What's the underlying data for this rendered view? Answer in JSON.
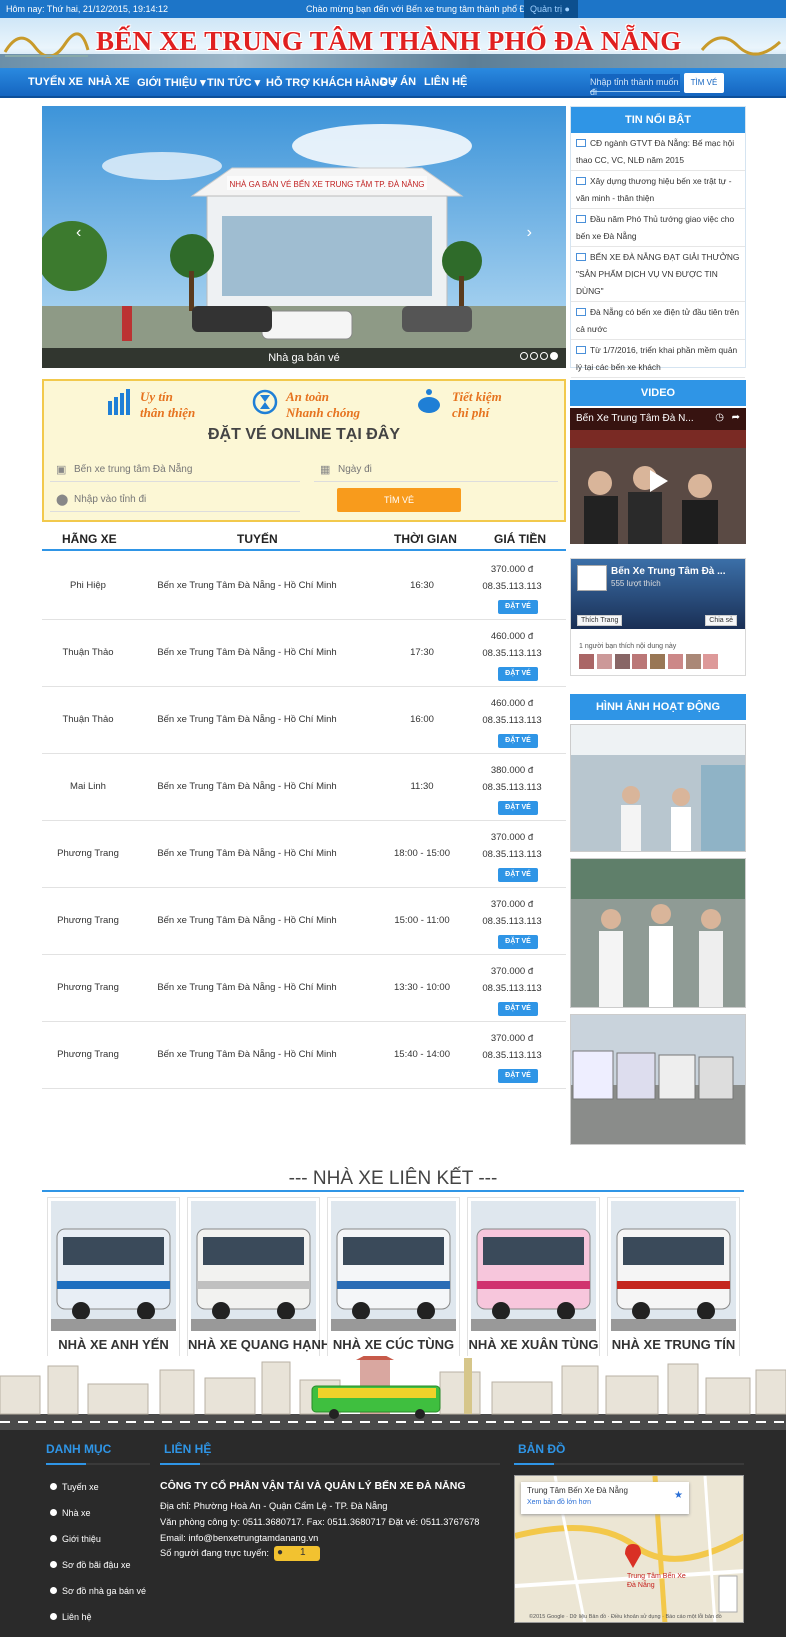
{
  "topbar": {
    "date": "Hôm nay: Thứ hai, 21/12/2015, 19:14:12",
    "welcome": "Chào mừng bạn đến với Bến xe trung tâm thành phố Đà Nẵng",
    "admin": "Quản trị"
  },
  "header": {
    "title": "BẾN XE TRUNG TÂM THÀNH PHỐ ĐÀ NẴNG"
  },
  "nav": {
    "items": [
      "TUYẾN XE",
      "NHÀ XE",
      "GIỚI THIỆU ▾",
      "TIN TỨC ▾",
      "HỖ TRỢ KHÁCH HÀNG ▾",
      "DỰ ÁN",
      "LIÊN HỆ"
    ],
    "search_placeholder": "Nhập tỉnh thành muốn đi",
    "search_button": "TÌM VÉ"
  },
  "slider": {
    "caption": "Nhà ga bán vé",
    "sign": "NHÀ GA BÁN VÉ BẾN XE TRUNG TÂM TP. ĐÀ NẴNG",
    "slide_count": 4,
    "active": 4
  },
  "news": {
    "title": "TIN NỔI BẬT",
    "items": [
      "CĐ ngành GTVT Đà Nẵng: Bế mạc hội thao CC, VC, NLĐ năm 2015",
      "Xây dựng thương hiệu bến xe trật tự - văn minh - thân thiện",
      "Đầu năm Phó Thủ tướng giao việc cho bến xe Đà Nẵng",
      "BẾN XE ĐÀ NẴNG ĐẠT GIẢI THƯỞNG \"SẢN PHẨM DỊCH VỤ VN ĐƯỢC TIN DÙNG\"",
      "Đà Nẵng có bến xe điện tử đầu tiên trên cả nước",
      "Từ 1/7/2016, triển khai phần mềm quản lý tại các bến xe khách"
    ]
  },
  "booking": {
    "features": [
      {
        "line1": "Uy tín",
        "line2": "thân thiện"
      },
      {
        "line1": "An toàn",
        "line2": "Nhanh chóng"
      },
      {
        "line1": "Tiết kiệm",
        "line2": "chi phí"
      }
    ],
    "title": "ĐẶT VÉ ONLINE TẠI ĐÂY",
    "from_value": "Bến xe trung tâm Đà Nẵng",
    "date_placeholder": "Ngày đi",
    "to_placeholder": "Nhập vào tỉnh đi",
    "button": "TÌM VÉ"
  },
  "table": {
    "headers": [
      "HÃNG XE",
      "TUYẾN",
      "THỜI GIAN",
      "GIÁ TIỀN"
    ],
    "book_label": "ĐẶT VÉ",
    "rows": [
      {
        "company": "Phi Hiệp",
        "route": "Bến xe Trung Tâm Đà Nẵng - Hồ Chí Minh",
        "time": "16:30",
        "price": "370.000 đ",
        "phone": "08.35.113.113"
      },
      {
        "company": "Thuận Thảo",
        "route": "Bến xe Trung Tâm Đà Nẵng - Hồ Chí Minh",
        "time": "17:30",
        "price": "460.000 đ",
        "phone": "08.35.113.113"
      },
      {
        "company": "Thuận Thảo",
        "route": "Bến xe Trung Tâm Đà Nẵng - Hồ Chí Minh",
        "time": "16:00",
        "price": "460.000 đ",
        "phone": "08.35.113.113"
      },
      {
        "company": "Mai Linh",
        "route": "Bến xe Trung Tâm Đà Nẵng - Hồ Chí Minh",
        "time": "11:30",
        "price": "380.000 đ",
        "phone": "08.35.113.113"
      },
      {
        "company": "Phương Trang",
        "route": "Bến xe Trung Tâm Đà Nẵng - Hồ Chí Minh",
        "time": "18:00 - 15:00",
        "price": "370.000 đ",
        "phone": "08.35.113.113"
      },
      {
        "company": "Phương Trang",
        "route": "Bến xe Trung Tâm Đà Nẵng - Hồ Chí Minh",
        "time": "15:00 - 11:00",
        "price": "370.000 đ",
        "phone": "08.35.113.113"
      },
      {
        "company": "Phương Trang",
        "route": "Bến xe Trung Tâm Đà Nẵng - Hồ Chí Minh",
        "time": "13:30 - 10:00",
        "price": "370.000 đ",
        "phone": "08.35.113.113"
      },
      {
        "company": "Phương Trang",
        "route": "Bến xe Trung Tâm Đà Nẵng - Hồ Chí Minh",
        "time": "15:40 - 14:00",
        "price": "370.000 đ",
        "phone": "08.35.113.113"
      }
    ]
  },
  "video": {
    "title": "VIDEO",
    "video_title": "Bến Xe Trung Tâm Đà N..."
  },
  "facebook": {
    "page_name": "Bến Xe Trung Tâm Đà ...",
    "likes": "555 lượt thích",
    "like_button": "Thích Trang",
    "share_button": "Chia sẻ",
    "friends_text": "1 người bạn thích nội dung này"
  },
  "photos": {
    "title": "HÌNH ẢNH HOẠT ĐỘNG"
  },
  "partners": {
    "title": "--- NHÀ XE LIÊN KẾT ---",
    "items": [
      {
        "name": "NHÀ XE ANH YẾN",
        "color": "#e8eef5",
        "stripe": "#1f6fbf"
      },
      {
        "name": "NHÀ XE QUANG HẠNH",
        "color": "#f2f2f0",
        "stripe": "#c0c0c0"
      },
      {
        "name": "NHÀ XE CÚC TÙNG",
        "color": "#f4f6f8",
        "stripe": "#2a6cb5"
      },
      {
        "name": "NHÀ XE XUÂN TÙNG",
        "color": "#f7c6dc",
        "stripe": "#d0336f"
      },
      {
        "name": "NHÀ XE TRUNG TÍN",
        "color": "#f5f5f5",
        "stripe": "#c4261d"
      }
    ]
  },
  "footer": {
    "menu_title": "DANH MỤC",
    "menu": [
      "Tuyến xe",
      "Nhà xe",
      "Giới thiệu",
      "Sơ đồ bãi đậu xe",
      "Sơ đồ nhà ga bán vé",
      "Liên hệ"
    ],
    "contact_title": "LIÊN HỆ",
    "company": "CÔNG TY CỔ PHẦN VẬN TẢI VÀ QUẢN LÝ BẾN XE ĐÀ NẴNG",
    "address": "Địa chỉ: Phường Hoà An - Quận Cẩm Lệ - TP. Đà Nẵng",
    "office": "Văn phòng công ty: 0511.3680717. Fax: 0511.3680717 Đặt vé: 0511.3767678",
    "email": "Email: info@benxetrungtamdanang.vn",
    "online_label": "Số người đang trực tuyến:",
    "online_count": "1",
    "map_title": "BẢN ĐỒ",
    "map_place": "Trung Tâm Bến Xe Đà Nẵng",
    "map_link": "Xem bản đồ lớn hơn",
    "map_pin_label": "Trung Tâm Bến Xe Đà Nẵng",
    "map_attrib": "©2015 Google · Dữ liệu Bản đồ · Điều khoản sử dụng · Báo cáo một lỗi bản đồ"
  },
  "colors": {
    "primary": "#2f95e6",
    "nav": "#1565c0",
    "accent_orange": "#f89b1c",
    "title_red": "#e02020",
    "footer_bg": "#2a2a2a"
  }
}
